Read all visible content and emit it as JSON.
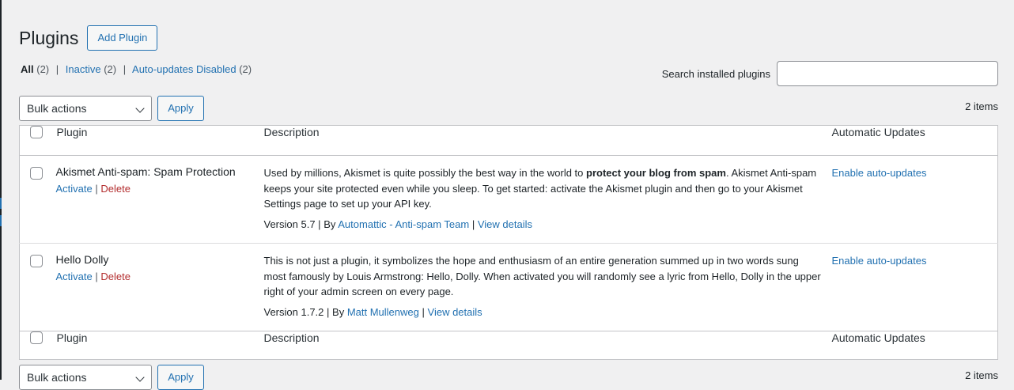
{
  "page": {
    "title": "Plugins",
    "add_button": "Add Plugin"
  },
  "filters": {
    "all_label": "All",
    "all_count": "(2)",
    "inactive_label": "Inactive",
    "inactive_count": "(2)",
    "autoupdates_label": "Auto-updates Disabled",
    "autoupdates_count": "(2)",
    "separator": "|"
  },
  "search": {
    "label": "Search installed plugins",
    "value": ""
  },
  "tablenav": {
    "bulk_actions": "Bulk actions",
    "apply": "Apply",
    "items": "2 items"
  },
  "columns": {
    "plugin": "Plugin",
    "description": "Description",
    "auto_updates": "Automatic Updates"
  },
  "plugins": [
    {
      "name": "Akismet Anti-spam: Spam Protection",
      "activate": "Activate",
      "delete": "Delete",
      "desc_before": "Used by millions, Akismet is quite possibly the best way in the world to ",
      "desc_bold": "protect your blog from spam",
      "desc_after": ". Akismet Anti-spam keeps your site protected even while you sleep. To get started: activate the Akismet plugin and then go to your Akismet Settings page to set up your API key.",
      "version": "Version 5.7",
      "by": "By",
      "author": "Automattic - Anti-spam Team",
      "view_details": "View details",
      "auto_update": "Enable auto-updates"
    },
    {
      "name": "Hello Dolly",
      "activate": "Activate",
      "delete": "Delete",
      "desc": "This is not just a plugin, it symbolizes the hope and enthusiasm of an entire generation summed up in two words sung most famously by Louis Armstrong: Hello, Dolly. When activated you will randomly see a lyric from Hello, Dolly in the upper right of your admin screen on every page.",
      "version": "Version 1.7.2",
      "by": "By",
      "author": "Matt Mullenweg",
      "view_details": "View details",
      "auto_update": "Enable auto-updates"
    }
  ],
  "colors": {
    "link": "#2271b1",
    "delete": "#b32d2e",
    "background": "#f0f0f1"
  }
}
